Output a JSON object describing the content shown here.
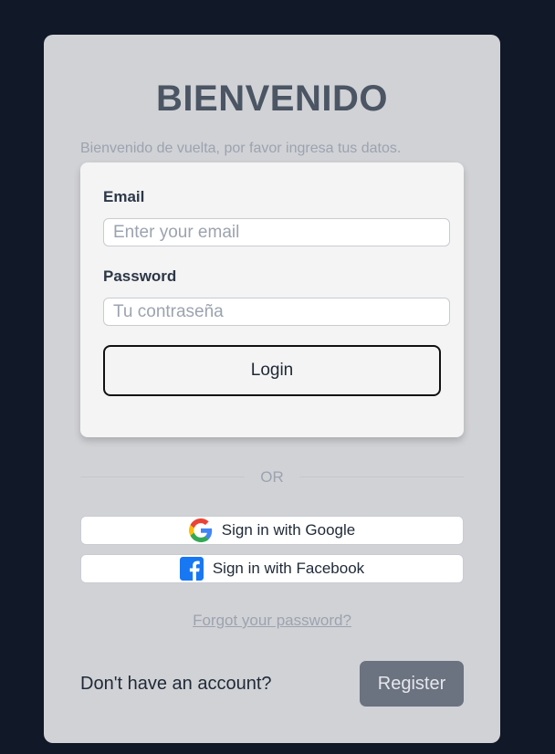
{
  "header": {
    "title": "BIENVENIDO",
    "subtitle": "Bienvenido de vuelta, por favor ingresa tus datos."
  },
  "form": {
    "email_label": "Email",
    "email_placeholder": "Enter your email",
    "password_label": "Password",
    "password_placeholder": "Tu contraseña",
    "login_label": "Login"
  },
  "divider": {
    "text": "OR"
  },
  "social": {
    "google_label": "Sign in with Google",
    "google_icon": "google-icon",
    "facebook_label": "Sign in with Facebook",
    "facebook_icon": "facebook-icon"
  },
  "links": {
    "forgot_password": "Forgot your password?"
  },
  "footer": {
    "no_account_text": "Don't have an account?",
    "register_label": "Register"
  },
  "colors": {
    "page_background": "#111827",
    "card_background": "#d1d2d6",
    "title": "#4b5563",
    "register_button": "#6b7280",
    "facebook_blue": "#1877f2"
  }
}
